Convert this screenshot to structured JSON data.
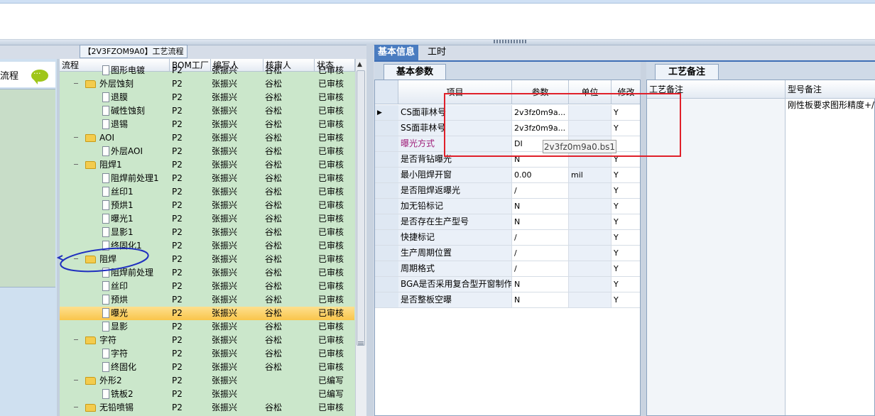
{
  "left_panel": {
    "label": "流程"
  },
  "tree": {
    "title": "【2V3FZOM9A0】工艺流程",
    "columns": [
      "流程",
      "BOM工厂",
      "编写人",
      "核审人",
      "状态"
    ],
    "rows": [
      {
        "indent": 3,
        "icon": "doc",
        "name": "图形电镀",
        "bom": "P2",
        "writer": "张振兴",
        "reviewer": "谷松",
        "status": "已审核"
      },
      {
        "indent": 2,
        "icon": "folder",
        "expand": "-",
        "name": "外层蚀刻",
        "bom": "P2",
        "writer": "张振兴",
        "reviewer": "谷松",
        "status": "已审核"
      },
      {
        "indent": 3,
        "icon": "doc",
        "name": "退膜",
        "bom": "P2",
        "writer": "张振兴",
        "reviewer": "谷松",
        "status": "已审核"
      },
      {
        "indent": 3,
        "icon": "doc",
        "name": "碱性蚀刻",
        "bom": "P2",
        "writer": "张振兴",
        "reviewer": "谷松",
        "status": "已审核"
      },
      {
        "indent": 3,
        "icon": "doc",
        "name": "退锡",
        "bom": "P2",
        "writer": "张振兴",
        "reviewer": "谷松",
        "status": "已审核"
      },
      {
        "indent": 2,
        "icon": "folder",
        "expand": "-",
        "name": "AOI",
        "bom": "P2",
        "writer": "张振兴",
        "reviewer": "谷松",
        "status": "已审核"
      },
      {
        "indent": 3,
        "icon": "doc",
        "name": "外层AOI",
        "bom": "P2",
        "writer": "张振兴",
        "reviewer": "谷松",
        "status": "已审核"
      },
      {
        "indent": 2,
        "icon": "folder",
        "expand": "-",
        "name": "阻焊1",
        "bom": "P2",
        "writer": "张振兴",
        "reviewer": "谷松",
        "status": "已审核"
      },
      {
        "indent": 3,
        "icon": "doc",
        "name": "阻焊前处理1",
        "bom": "P2",
        "writer": "张振兴",
        "reviewer": "谷松",
        "status": "已审核"
      },
      {
        "indent": 3,
        "icon": "doc",
        "name": "丝印1",
        "bom": "P2",
        "writer": "张振兴",
        "reviewer": "谷松",
        "status": "已审核"
      },
      {
        "indent": 3,
        "icon": "doc",
        "name": "预烘1",
        "bom": "P2",
        "writer": "张振兴",
        "reviewer": "谷松",
        "status": "已审核"
      },
      {
        "indent": 3,
        "icon": "doc",
        "name": "曝光1",
        "bom": "P2",
        "writer": "张振兴",
        "reviewer": "谷松",
        "status": "已审核"
      },
      {
        "indent": 3,
        "icon": "doc",
        "name": "显影1",
        "bom": "P2",
        "writer": "张振兴",
        "reviewer": "谷松",
        "status": "已审核"
      },
      {
        "indent": 3,
        "icon": "doc",
        "name": "终固化1",
        "bom": "P2",
        "writer": "张振兴",
        "reviewer": "谷松",
        "status": "已审核"
      },
      {
        "indent": 2,
        "icon": "folder",
        "expand": "-",
        "name": "阻焊",
        "bom": "P2",
        "writer": "张振兴",
        "reviewer": "谷松",
        "status": "已审核"
      },
      {
        "indent": 3,
        "icon": "doc",
        "name": "阻焊前处理",
        "bom": "P2",
        "writer": "张振兴",
        "reviewer": "谷松",
        "status": "已审核"
      },
      {
        "indent": 3,
        "icon": "doc",
        "name": "丝印",
        "bom": "P2",
        "writer": "张振兴",
        "reviewer": "谷松",
        "status": "已审核"
      },
      {
        "indent": 3,
        "icon": "doc",
        "name": "预烘",
        "bom": "P2",
        "writer": "张振兴",
        "reviewer": "谷松",
        "status": "已审核"
      },
      {
        "indent": 3,
        "icon": "doc",
        "name": "曝光",
        "bom": "P2",
        "writer": "张振兴",
        "reviewer": "谷松",
        "status": "已审核",
        "selected": true
      },
      {
        "indent": 3,
        "icon": "doc",
        "name": "显影",
        "bom": "P2",
        "writer": "张振兴",
        "reviewer": "谷松",
        "status": "已审核"
      },
      {
        "indent": 2,
        "icon": "folder",
        "expand": "-",
        "name": "字符",
        "bom": "P2",
        "writer": "张振兴",
        "reviewer": "谷松",
        "status": "已审核"
      },
      {
        "indent": 3,
        "icon": "doc",
        "name": "字符",
        "bom": "P2",
        "writer": "张振兴",
        "reviewer": "谷松",
        "status": "已审核"
      },
      {
        "indent": 3,
        "icon": "doc",
        "name": "终固化",
        "bom": "P2",
        "writer": "张振兴",
        "reviewer": "谷松",
        "status": "已审核"
      },
      {
        "indent": 2,
        "icon": "folder",
        "expand": "-",
        "name": "外形2",
        "bom": "P2",
        "writer": "张振兴",
        "reviewer": "",
        "status": "已编写"
      },
      {
        "indent": 3,
        "icon": "doc",
        "name": "铣板2",
        "bom": "P2",
        "writer": "张振兴",
        "reviewer": "",
        "status": "已编写"
      },
      {
        "indent": 2,
        "icon": "folder",
        "expand": "-",
        "name": "无铅喷锡",
        "bom": "P2",
        "writer": "张振兴",
        "reviewer": "谷松",
        "status": "已审核"
      }
    ]
  },
  "tabs": {
    "basic_info": "基本信息",
    "man_hours": "工时",
    "basic_params": "基本参数",
    "process_notes": "工艺备注"
  },
  "params": {
    "columns": [
      "项目",
      "参数",
      "单位",
      "修改"
    ],
    "rows": [
      {
        "name": "CS面菲林号",
        "value": "2v3fz0m9a...",
        "unit": "",
        "mod": "Y",
        "current": true
      },
      {
        "name": "SS面菲林号",
        "value": "2v3fz0m9a...",
        "unit": "",
        "mod": "Y"
      },
      {
        "name": "曝光方式",
        "value": "DI",
        "unit": "",
        "mod": "",
        "highlight": true
      },
      {
        "name": "是否背钻曝光",
        "value": "N",
        "unit": "",
        "mod": "Y"
      },
      {
        "name": "最小阻焊开窗",
        "value": "0.00",
        "unit": "mil",
        "mod": "Y"
      },
      {
        "name": "是否阻焊返曝光",
        "value": "/",
        "unit": "",
        "mod": "Y"
      },
      {
        "name": "加无铅标记",
        "value": "N",
        "unit": "",
        "mod": "Y"
      },
      {
        "name": "是否存在生产型号",
        "value": "N",
        "unit": "",
        "mod": "Y"
      },
      {
        "name": "快捷标记",
        "value": "/",
        "unit": "",
        "mod": "Y"
      },
      {
        "name": "生产周期位置",
        "value": "/",
        "unit": "",
        "mod": "Y"
      },
      {
        "name": "周期格式",
        "value": "/",
        "unit": "",
        "mod": "Y"
      },
      {
        "name": "BGA是否采用复合型开窗制作",
        "value": "N",
        "unit": "",
        "mod": "Y"
      },
      {
        "name": "是否整板空曝",
        "value": "N",
        "unit": "",
        "mod": "Y"
      }
    ],
    "tooltip": "2v3fz0m9a0.bs1"
  },
  "notes": {
    "col1": "工艺备注",
    "col2": "型号备注",
    "model_note": "刚性板要求图形精度+/"
  },
  "colors": {
    "tree_bg": "#cbe7cb",
    "selected_row": "#f9c54b",
    "tab_active": "#4a7cc0",
    "annotation_red": "#e0202a",
    "annotation_blue": "#1f2fbf"
  }
}
